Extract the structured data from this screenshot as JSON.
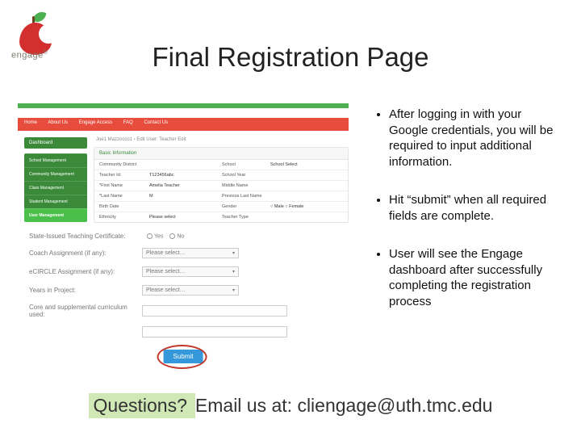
{
  "logo_text": "engage",
  "title": "Final Registration Page",
  "bullets": [
    "After logging in with your Google credentials, you will be required to input additional information.",
    "Hit “submit” when all required fields are complete.",
    "User will see the Engage dashboard after successfully completing the registration process"
  ],
  "footer": {
    "lead": "Questions?  ",
    "rest": "Email us at: cliengage@uth.tmc.edu"
  },
  "sc": {
    "nav": [
      "Home",
      "About Us",
      "Engage Access",
      "FAQ",
      "Contact Us"
    ],
    "dashboard": "Dashboard",
    "sidebar": [
      "School Management",
      "Community Management",
      "Class Management",
      "Student Management",
      "User Management"
    ],
    "crumb": "Joe1 Mazzocco1 › Edit User: Teacher Edit",
    "panel_title": "Basic Information",
    "rows": [
      {
        "l1": "Community District",
        "v1": "",
        "l2": "School",
        "v2": "School Select"
      },
      {
        "l1": "Teacher Id:",
        "v1": "T123456abc",
        "l2": "School Year",
        "v2": ""
      },
      {
        "l1": "*First Name",
        "v1": "Amelia Teacher",
        "l2": "Middle Name",
        "v2": ""
      },
      {
        "l1": "*Last Name",
        "v1": "M",
        "l2": "Previous Last Name",
        "v2": ""
      },
      {
        "l1": "Birth Date",
        "v1": "",
        "l2": "Gender",
        "v2": "○ Male ○ Female"
      },
      {
        "l1": "Ethnicity",
        "v1": "Please select",
        "l2": "Teacher Type",
        "v2": ""
      }
    ],
    "cert_label": "State-Issued Teaching Certificate:",
    "cert_opts": [
      "Yes",
      "No"
    ],
    "ext": [
      {
        "label": "Coach Assignment (if any):",
        "type": "select",
        "value": "Please select…"
      },
      {
        "label": "eCIRCLE Assignment (if any):",
        "type": "select",
        "value": "Please select…"
      },
      {
        "label": "Years in Project:",
        "type": "select",
        "value": "Please select…"
      },
      {
        "label": "Core and supplemental curriculum used:",
        "type": "input",
        "value": ""
      }
    ],
    "submit": "Submit"
  }
}
